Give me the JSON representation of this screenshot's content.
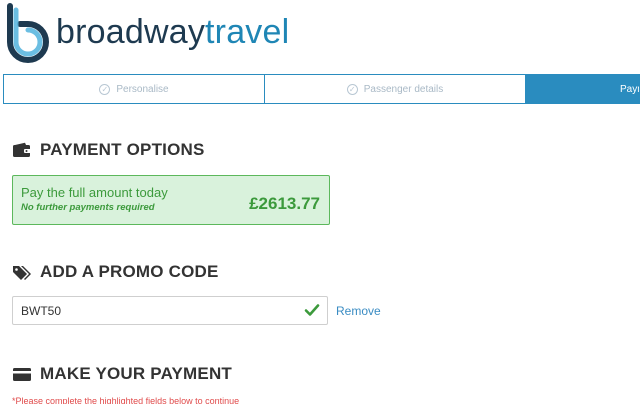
{
  "brand": {
    "name_part1": "broadway",
    "name_part2": "travel",
    "primary_color": "#1e3a50",
    "accent_color": "#1f86b5"
  },
  "steps": [
    {
      "label": "Personalise",
      "state": "completed"
    },
    {
      "label": "Passenger details",
      "state": "completed"
    },
    {
      "label": "Payment",
      "state": "active"
    }
  ],
  "payment_options": {
    "title": "PAYMENT OPTIONS",
    "option": {
      "title": "Pay the full amount today",
      "subtitle": "No further payments required",
      "amount": "£2613.77",
      "selected": true
    }
  },
  "promo": {
    "title": "ADD A PROMO CODE",
    "value": "BWT50",
    "remove_label": "Remove"
  },
  "make_payment": {
    "title": "MAKE YOUR PAYMENT",
    "warning": "*Please complete the highlighted fields below to continue"
  },
  "colors": {
    "success": "#3c9a3c",
    "success_bg": "#d9f2dc",
    "step_active": "#2a8cbf",
    "link": "#3a8cc3",
    "error": "#e04b4b"
  }
}
